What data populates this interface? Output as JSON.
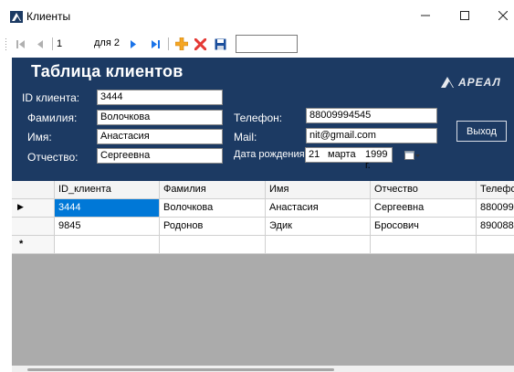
{
  "window": {
    "title": "Клиенты"
  },
  "navigator": {
    "position": "1",
    "of_label": "для 2",
    "search_value": ""
  },
  "form": {
    "title": "Таблица клиентов",
    "logo_text": "АРЕАЛ",
    "id_label": "ID клиента:",
    "id_value": "3444",
    "last_name_label": "Фамилия:",
    "last_name_value": "Волочкова",
    "first_name_label": "Имя:",
    "first_name_value": "Анастасия",
    "patronymic_label": "Отчество:",
    "patronymic_value": "Сергеевна",
    "phone_label": "Телефон:",
    "phone_value": "88009994545",
    "mail_label": "Mail:",
    "mail_value": "nit@gmail.com",
    "birth_label": "Дата рождения:",
    "birth_day": "21",
    "birth_month": "марта",
    "birth_year": "1999 г.",
    "exit_label": "Выход"
  },
  "grid": {
    "columns": [
      "ID_клиента",
      "Фамилия",
      "Имя",
      "Отчество",
      "Телефо"
    ],
    "rows": [
      [
        "3444",
        "Волочкова",
        "Анастасия",
        "Сергеевна",
        "8800999"
      ],
      [
        "9845",
        "Родонов",
        "Эдик",
        "Бросович",
        "8900888"
      ]
    ],
    "current_row_marker": "▶",
    "new_row_marker": "*"
  },
  "colors": {
    "panel": "#1c3a63",
    "selection": "#0078d7",
    "nav_arrow": "#1a73e8",
    "delete": "#e53935",
    "add": "#f5a623"
  },
  "icons": [
    "app-icon",
    "first-record-icon",
    "prev-record-icon",
    "next-record-icon",
    "last-record-icon",
    "add-icon",
    "delete-icon",
    "save-icon",
    "calendar-icon"
  ]
}
